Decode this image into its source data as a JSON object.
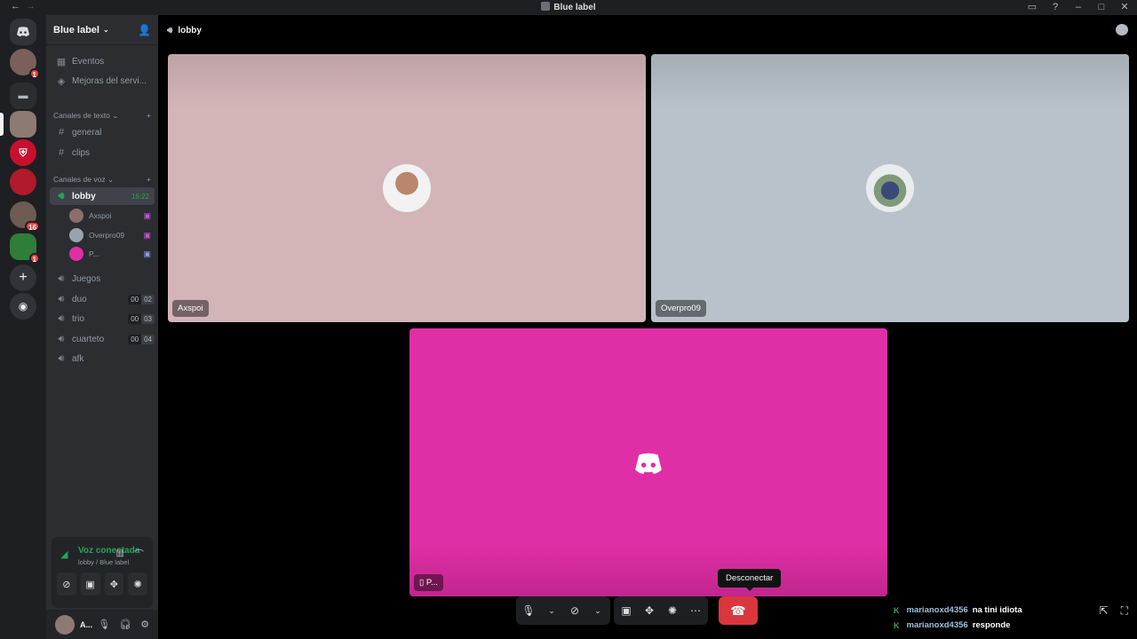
{
  "window": {
    "title": "Blue label"
  },
  "server": {
    "name": "Blue label",
    "top_items": [
      "Eventos",
      "Mejoras del servi..."
    ],
    "text_category": "Canales de texto",
    "text_channels": [
      "general",
      "clips"
    ],
    "voice_category": "Canales de voz",
    "lobby": {
      "name": "lobby",
      "time": "16:22"
    },
    "voice_users": [
      "Axspoi",
      "Overpro09",
      "P..."
    ],
    "voice_channels": [
      {
        "name": "Juegos",
        "c1": "",
        "c2": ""
      },
      {
        "name": "duo",
        "c1": "00",
        "c2": "02"
      },
      {
        "name": "trio",
        "c1": "00",
        "c2": "03"
      },
      {
        "name": "cuarteto",
        "c1": "00",
        "c2": "04"
      },
      {
        "name": "afk",
        "c1": "",
        "c2": ""
      }
    ]
  },
  "guilds": {
    "badges": [
      "1",
      "16",
      "1"
    ]
  },
  "voice_panel": {
    "status": "Voz conectada",
    "location": "lobby / Blue label"
  },
  "user": {
    "name": "A..."
  },
  "main": {
    "channel": "lobby",
    "tiles": [
      {
        "label": "Axspoi",
        "bg": "#d3b5b8"
      },
      {
        "label": "Overpro09",
        "bg": "#b9c2ca"
      },
      {
        "label": "P...",
        "bg": "#e02fa6"
      }
    ],
    "tooltip": "Desconectar"
  },
  "chat": [
    {
      "user": "marianoxd4356",
      "message": "na tini idiota"
    },
    {
      "user": "marianoxd4356",
      "message": "responde"
    }
  ],
  "colors": {
    "accent_green": "#23a55a",
    "hangup_red": "#da373c",
    "discord_pink": "#e02fa6"
  }
}
